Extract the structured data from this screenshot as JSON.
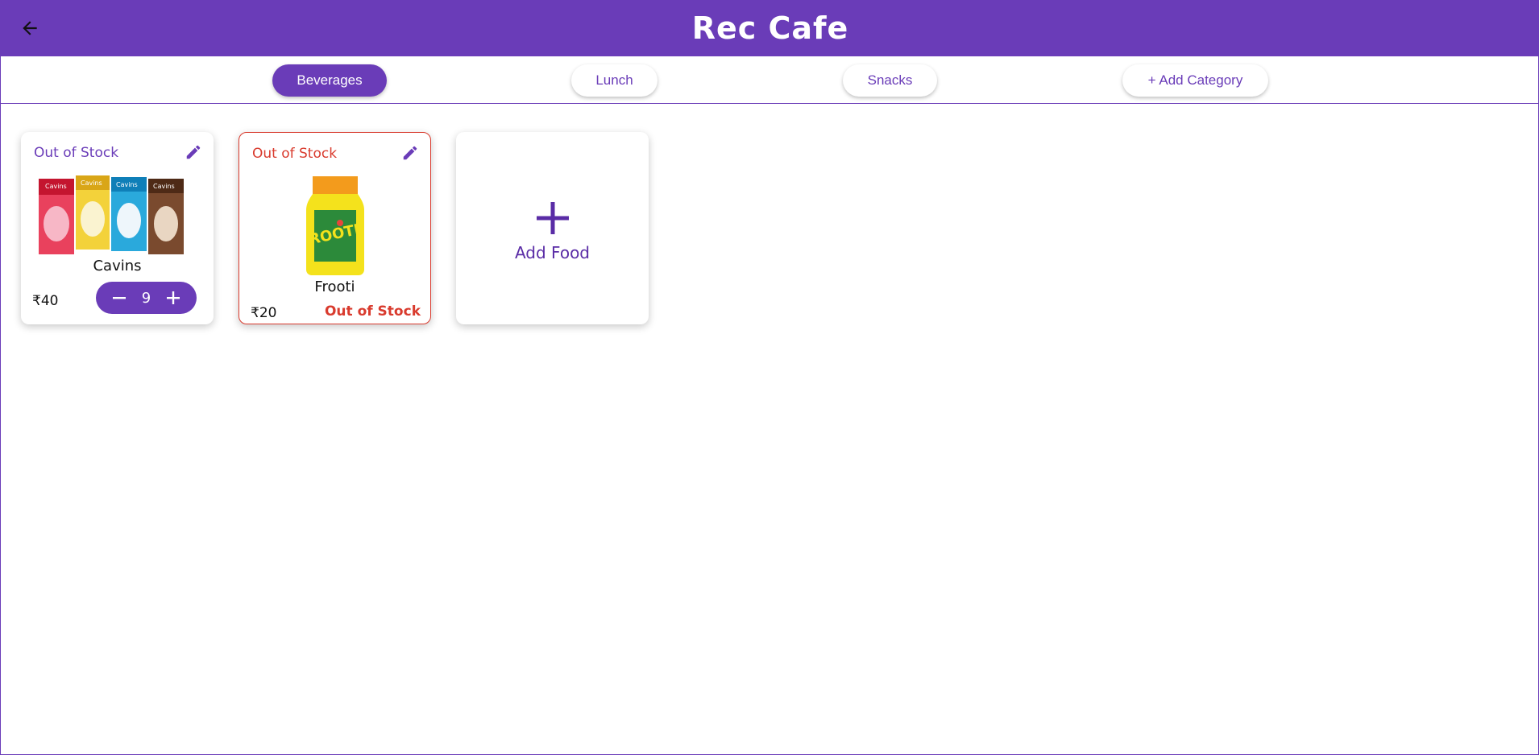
{
  "header": {
    "title": "Rec Cafe",
    "back_icon": "arrow-left-icon"
  },
  "tabs": [
    {
      "label": "Beverages",
      "active": true
    },
    {
      "label": "Lunch",
      "active": false
    },
    {
      "label": "Snacks",
      "active": false
    },
    {
      "label": "+ Add Category",
      "active": false
    }
  ],
  "items": [
    {
      "name": "Cavins",
      "stock_label": "Out of Stock",
      "price": "₹40",
      "quantity": "9",
      "image_icon": "cavins-milkshake-image"
    },
    {
      "name": "Frooti",
      "stock_label": "Out of Stock",
      "price": "₹20",
      "footer_status": "Out of Stock",
      "image_icon": "frooti-bottle-image"
    }
  ],
  "add_food": {
    "label": "Add Food",
    "icon": "plus-icon"
  },
  "colors": {
    "primary": "#6a3cb8",
    "danger": "#d93b2e",
    "background": "#ffffff"
  }
}
